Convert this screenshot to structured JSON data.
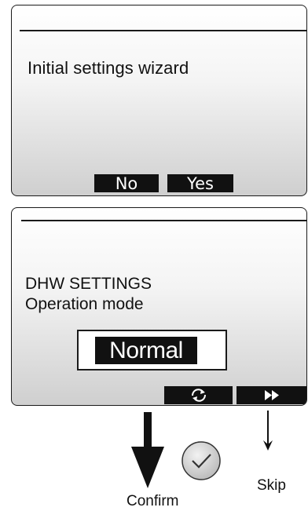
{
  "screen1": {
    "message": "Initial settings wizard",
    "softkeys": {
      "no_label": "No",
      "yes_label": "Yes"
    }
  },
  "screen2": {
    "title": "DHW SETTINGS",
    "subtitle": "Operation mode",
    "selected_mode": "Normal",
    "function_keys": [
      {
        "icon": "cycle-arrows-icon"
      },
      {
        "icon": "fast-forward-icon"
      }
    ]
  },
  "annotations": {
    "confirm_label": "Confirm",
    "skip_label": "Skip",
    "confirm_icon": "checkmark-circle-icon",
    "confirm_arrow": "down-arrow-icon",
    "skip_arrow": "thin-down-arrow-icon"
  }
}
